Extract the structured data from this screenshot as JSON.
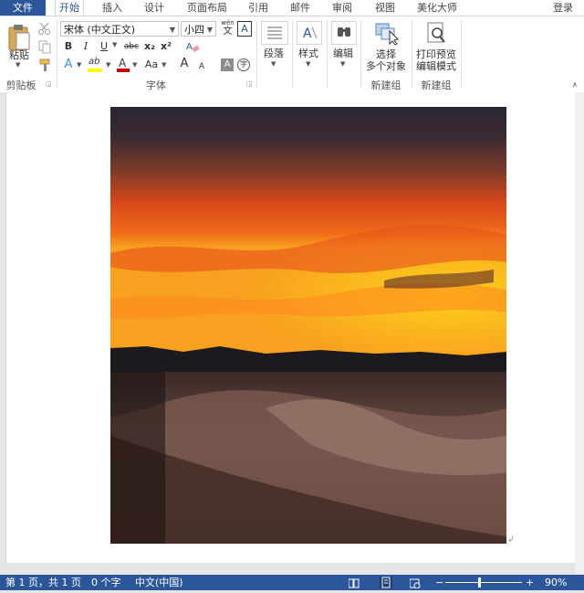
{
  "tabs": {
    "file": "文件",
    "home": "开始",
    "insert": "插入",
    "design": "设计",
    "layout": "页面布局",
    "references": "引用",
    "mailings": "邮件",
    "review": "审阅",
    "view": "视图",
    "beautify": "美化大师",
    "login": "登录"
  },
  "clipboard": {
    "paste_label": "粘贴",
    "group_label": "剪贴板"
  },
  "font": {
    "font_name": "宋体 (中文正文)",
    "font_size": "小四",
    "bold": "B",
    "italic": "I",
    "underline": "U",
    "strikethrough": "abc",
    "subscript": "x₂",
    "superscript": "x²",
    "grow": "A",
    "shrink": "A",
    "change_case": "Aa",
    "pinyin_top": "wén",
    "pinyin_bottom": "文",
    "char_border": "A",
    "text_effect": "A",
    "highlight": "ab",
    "font_color": "A",
    "char_shading": "A",
    "enclose": "字",
    "group_label": "字体"
  },
  "paragraph": {
    "label": "段落"
  },
  "styles": {
    "label": "样式"
  },
  "editing": {
    "label": "编辑"
  },
  "newgroup1": {
    "select_line1": "选择",
    "select_line2": "多个对象",
    "group_label": "新建组"
  },
  "newgroup2": {
    "print_line1": "打印预览",
    "print_line2": "编辑模式",
    "group_label": "新建组"
  },
  "document": {
    "image_alt": "沙漠日落照片",
    "paragraph_mark": "↲"
  },
  "status": {
    "page": "第 1 页，共 1 页",
    "words": "0 个字",
    "language": "中文(中国)",
    "zoom": "90%",
    "zoom_fraction": 0.9
  },
  "colors": {
    "brand": "#2b579a",
    "highlight": "#ffff00",
    "font_color": "#c00000"
  }
}
